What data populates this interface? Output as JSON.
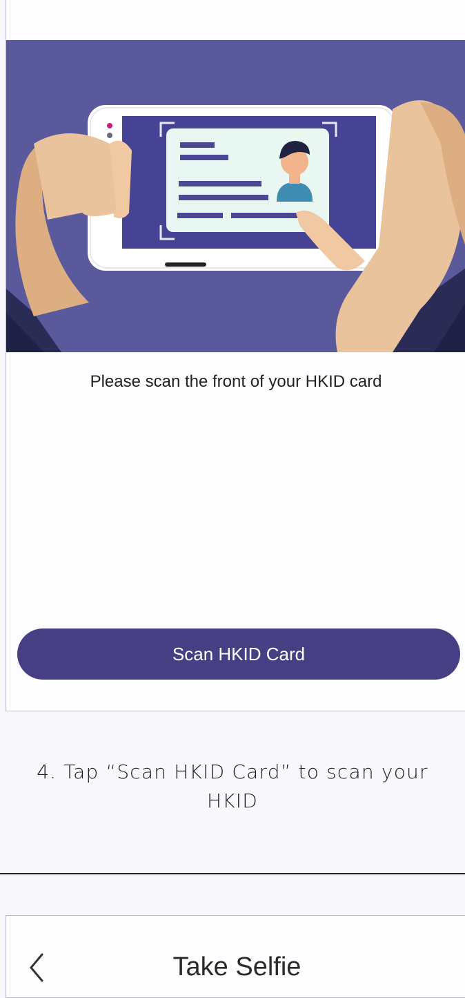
{
  "screen1": {
    "instruction": "Please scan the front of your HKID card",
    "cta_label": "Scan HKID Card"
  },
  "step_caption": {
    "line1": "4. Tap “Scan HKID Card” to scan your",
    "line2": "HKID"
  },
  "screen2": {
    "title": "Take Selfie",
    "back_icon": "chevron-left-icon"
  },
  "colors": {
    "brand": "#463f84",
    "illustration_bg": "#5a599c"
  }
}
